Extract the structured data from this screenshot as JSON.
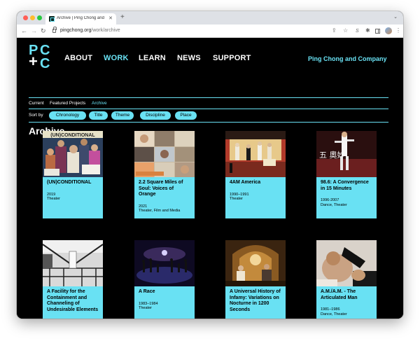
{
  "browser": {
    "tab_title": "Archive | Ping Chong and Comp",
    "url_host": "pingchong.org",
    "url_path": "/work/archive"
  },
  "site": {
    "logo": {
      "line1": "PC",
      "line2": "+C"
    },
    "nav": [
      {
        "label": "ABOUT",
        "active": false
      },
      {
        "label": "WORK",
        "active": true
      },
      {
        "label": "LEARN",
        "active": false
      },
      {
        "label": "NEWS",
        "active": false
      },
      {
        "label": "SUPPORT",
        "active": false
      }
    ],
    "brand": "Ping Chong and Company",
    "accent_color": "#69e1f3"
  },
  "subnav": {
    "items": [
      {
        "label": "Current",
        "active": false
      },
      {
        "label": "Featured Projects",
        "active": false
      },
      {
        "label": "Archive",
        "active": true
      }
    ]
  },
  "sort": {
    "label": "Sort by",
    "options": [
      "Chronology",
      "Title",
      "Theme",
      "Discipline",
      "Place"
    ]
  },
  "page_title": "Archive",
  "cards": [
    {
      "title": "(UN)CONDITIONAL",
      "years": "2019",
      "discipline": "Theater",
      "thumb_text": "(UN)CONDITIONAL"
    },
    {
      "title": "2.2 Square Miles of Soul: Voices of Orange",
      "years": "2021",
      "discipline": "Theater, Film and Media"
    },
    {
      "title": "4AM America",
      "years": "1990–1991",
      "discipline": "Theater"
    },
    {
      "title": "98.6: A Convergence in 15 Minutes",
      "years": "1996-2007",
      "discipline": "Dance, Theater",
      "thumb_text": "五 奧妙"
    },
    {
      "title": "A Facility for the Containment and Channeling of Undesirable Elements",
      "years": "",
      "discipline": ""
    },
    {
      "title": "A Race",
      "years": "1983–1984",
      "discipline": "Theater"
    },
    {
      "title": "A Universal History of Infamy: Variations on Nocturne in 1200 Seconds",
      "years": "",
      "discipline": ""
    },
    {
      "title": "A.M./A.M. - The Articulated Man",
      "years": "1981–1986",
      "discipline": "Dance, Theater"
    }
  ]
}
